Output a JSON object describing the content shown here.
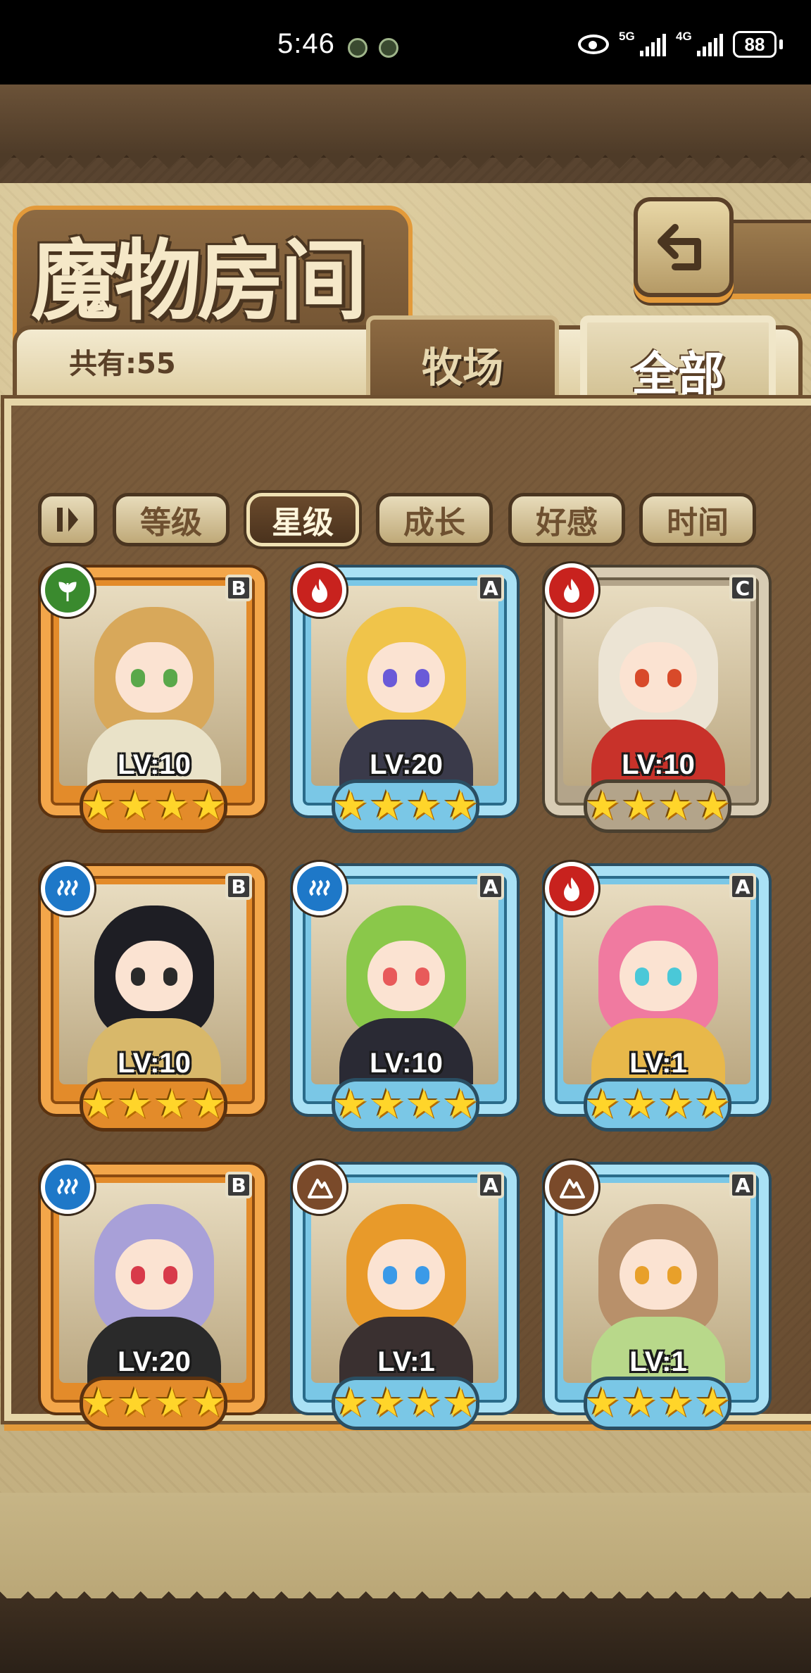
{
  "status_bar": {
    "time": "5:46",
    "network_1": "5G",
    "network_2": "4G",
    "battery": "88"
  },
  "header": {
    "title": "魔物房间",
    "back_icon": "return-arrow-icon"
  },
  "summary": {
    "count_label": "共有:55"
  },
  "tabs": [
    {
      "label": "牧场",
      "active": false
    },
    {
      "label": "全部",
      "active": true
    }
  ],
  "sort": {
    "icon": "sort-toggle-icon",
    "filters": [
      {
        "label": "等级",
        "active": false
      },
      {
        "label": "星级",
        "active": true
      },
      {
        "label": "成长",
        "active": false
      },
      {
        "label": "好感",
        "active": false
      },
      {
        "label": "时间",
        "active": false
      }
    ]
  },
  "monsters": [
    {
      "level": "LV:10",
      "rank": "B",
      "element": "nature",
      "stars": 4,
      "frame": "gold",
      "hair": "#d8a85a",
      "eyes": "#5aa84a",
      "outfit": "#e9e2c8"
    },
    {
      "level": "LV:20",
      "rank": "A",
      "element": "fire",
      "stars": 4,
      "frame": "blue",
      "hair": "#f0c44a",
      "eyes": "#6a5ad8",
      "outfit": "#3a3a4a"
    },
    {
      "level": "LV:10",
      "rank": "C",
      "element": "fire",
      "stars": 4,
      "frame": "grey",
      "hair": "#ece4d4",
      "eyes": "#d84a2a",
      "outfit": "#c8322a"
    },
    {
      "level": "LV:10",
      "rank": "B",
      "element": "water",
      "stars": 4,
      "frame": "gold",
      "hair": "#1e1e24",
      "eyes": "#2a2a2a",
      "outfit": "#d8b86a"
    },
    {
      "level": "LV:10",
      "rank": "A",
      "element": "water",
      "stars": 4,
      "frame": "blue",
      "hair": "#8ac84a",
      "eyes": "#e85a5a",
      "outfit": "#2a2a34"
    },
    {
      "level": "LV:1",
      "rank": "A",
      "element": "fire",
      "stars": 4,
      "frame": "blue",
      "hair": "#f07aa0",
      "eyes": "#4ac8d8",
      "outfit": "#e8b84a"
    },
    {
      "level": "LV:20",
      "rank": "B",
      "element": "water",
      "stars": 4,
      "frame": "gold",
      "hair": "#a8a0d8",
      "eyes": "#d83a4a",
      "outfit": "#2a2a2a"
    },
    {
      "level": "LV:1",
      "rank": "A",
      "element": "earth",
      "stars": 4,
      "frame": "blue",
      "hair": "#e89a2a",
      "eyes": "#3a9ae8",
      "outfit": "#3a3030"
    },
    {
      "level": "LV:1",
      "rank": "A",
      "element": "earth",
      "stars": 4,
      "frame": "blue",
      "hair": "#b8906a",
      "eyes": "#e8a02a",
      "outfit": "#b8d88a"
    }
  ],
  "colors": {
    "fire": "#c8221e",
    "water": "#1e78c8",
    "nature": "#3a8a2e",
    "earth": "#7a4a2a",
    "accent_orange": "#e39a3a"
  }
}
